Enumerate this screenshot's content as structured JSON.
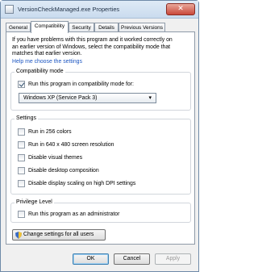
{
  "window": {
    "title": "VersionCheckManaged.exe Properties",
    "close_label": "✕"
  },
  "tabs": [
    {
      "label": "General",
      "active": false
    },
    {
      "label": "Compatibility",
      "active": true
    },
    {
      "label": "Security",
      "active": false
    },
    {
      "label": "Details",
      "active": false
    },
    {
      "label": "Previous Versions",
      "active": false
    }
  ],
  "intro": {
    "line1": "If you have problems with this program and it worked correctly on",
    "line2": "an earlier version of Windows, select the compatibility mode that",
    "line3": "matches that earlier version.",
    "help_link": "Help me choose the settings"
  },
  "compat_mode": {
    "title": "Compatibility mode",
    "checkbox_label": "Run this program in compatibility mode for:",
    "checked": true,
    "selected_os": "Windows XP (Service Pack 3)"
  },
  "settings": {
    "title": "Settings",
    "items": [
      {
        "label": "Run in 256 colors",
        "checked": false
      },
      {
        "label": "Run in 640 x 480 screen resolution",
        "checked": false
      },
      {
        "label": "Disable visual themes",
        "checked": false
      },
      {
        "label": "Disable desktop composition",
        "checked": false
      },
      {
        "label": "Disable display scaling on high DPI settings",
        "checked": false
      }
    ]
  },
  "privilege": {
    "title": "Privilege Level",
    "checkbox_label": "Run this program as an administrator",
    "checked": false
  },
  "buttons": {
    "change_all": "Change settings for all users",
    "ok": "OK",
    "cancel": "Cancel",
    "apply": "Apply"
  }
}
